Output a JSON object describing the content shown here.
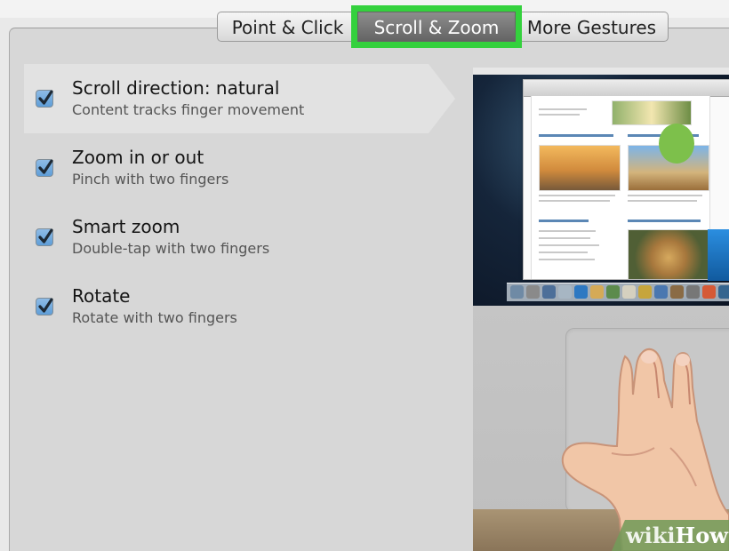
{
  "tabs": [
    {
      "label": "Point & Click",
      "selected": false
    },
    {
      "label": "Scroll & Zoom",
      "selected": true
    },
    {
      "label": "More Gestures",
      "selected": false
    }
  ],
  "options": [
    {
      "title": "Scroll direction: natural",
      "description": "Content tracks finger movement",
      "checked": true,
      "selected": true
    },
    {
      "title": "Zoom in or out",
      "description": "Pinch with two fingers",
      "checked": true,
      "selected": false
    },
    {
      "title": "Smart zoom",
      "description": "Double-tap with two fingers",
      "checked": true,
      "selected": false
    },
    {
      "title": "Rotate",
      "description": "Rotate with two fingers",
      "checked": true,
      "selected": false
    }
  ],
  "watermark": {
    "prefix": "wiki",
    "suffix": "How"
  },
  "colors": {
    "highlight": "#34d13d",
    "checkbox": "#5f9ed8",
    "selected_tab": "#777777"
  }
}
